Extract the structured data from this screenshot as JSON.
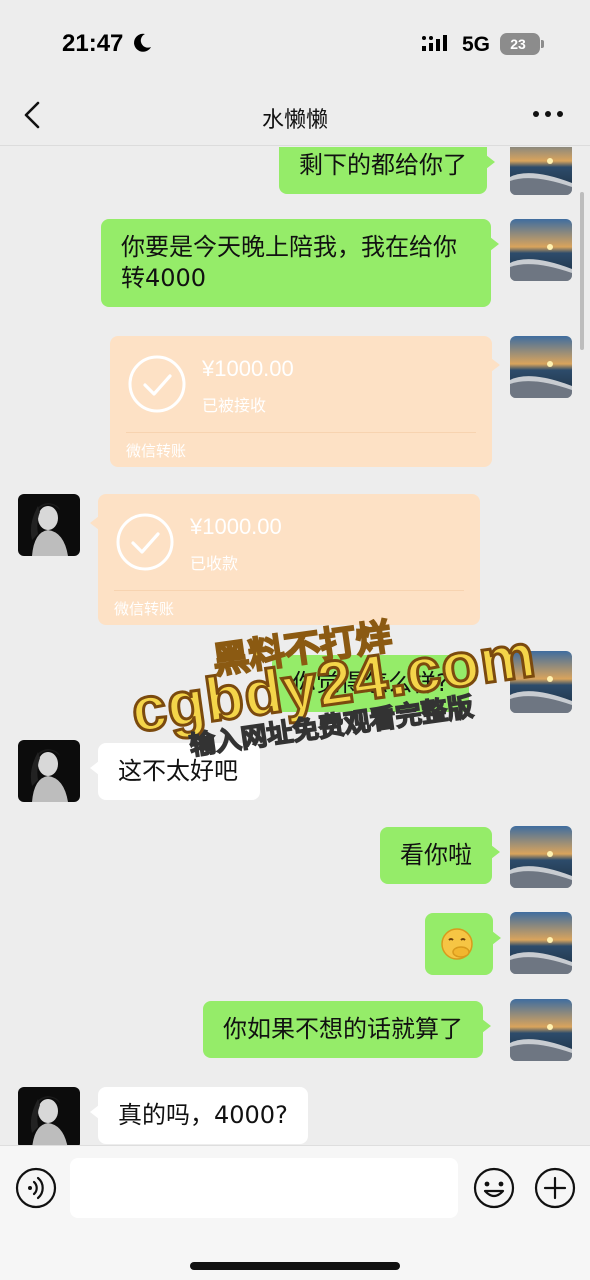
{
  "status_bar": {
    "time": "21:47",
    "network": "5G",
    "battery": "23"
  },
  "header": {
    "title": "水懒懒"
  },
  "messages": {
    "m0": {
      "text": "剩下的都给你了"
    },
    "m1": {
      "text": "你要是今天晚上陪我，我在给你转4000"
    },
    "t1": {
      "amount": "¥1000.00",
      "state": "已被接收",
      "brand": "微信转账"
    },
    "t2": {
      "amount": "¥1000.00",
      "state": "已收款",
      "brand": "微信转账"
    },
    "m2": {
      "text": "你觉得怎么样?"
    },
    "m3": {
      "text": "这不太好吧"
    },
    "m4": {
      "text": "看你啦"
    },
    "m5": {
      "text": "🤭"
    },
    "m6": {
      "text": "你如果不想的话就算了"
    },
    "m7": {
      "text": "真的吗，4000?"
    }
  },
  "watermark": {
    "line1": "黑料不打烊",
    "line2": "cgbdy24.com",
    "line3": "输入网址免费观看完整版"
  },
  "input": {
    "value": ""
  }
}
